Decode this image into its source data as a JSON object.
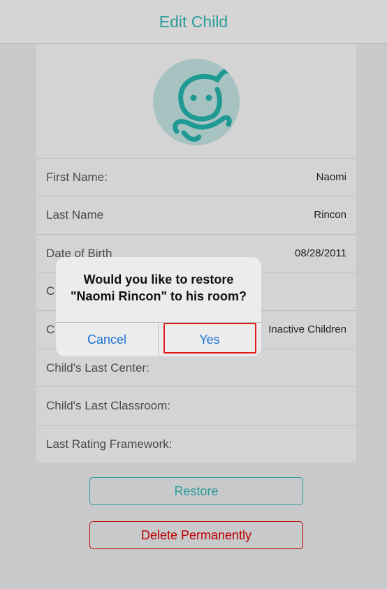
{
  "navbar": {
    "title": "Edit Child"
  },
  "avatar": {
    "icon": "child-avatar-icon"
  },
  "form": {
    "rows": [
      {
        "label": "First Name:",
        "value": "Naomi"
      },
      {
        "label": "Last Name",
        "value": "Rincon"
      },
      {
        "label": "Date of Birth",
        "value": "08/28/2011"
      },
      {
        "label": "C",
        "value": ""
      },
      {
        "label": "C",
        "value": "Inactive Children"
      },
      {
        "label": "Child's Last Center:",
        "value": ""
      },
      {
        "label": "Child's Last Classroom:",
        "value": ""
      },
      {
        "label": "Last Rating Framework:",
        "value": ""
      }
    ]
  },
  "buttons": {
    "restore": "Restore",
    "delete": "Delete Permanently"
  },
  "alert": {
    "line1": "Would you like to restore",
    "line2": "\"Naomi Rincon\" to his room?",
    "cancel": "Cancel",
    "yes": "Yes"
  },
  "colors": {
    "accent": "#2c9c9a",
    "danger": "#c00000",
    "link": "#1a73d8",
    "highlight": "#e01e1e"
  }
}
